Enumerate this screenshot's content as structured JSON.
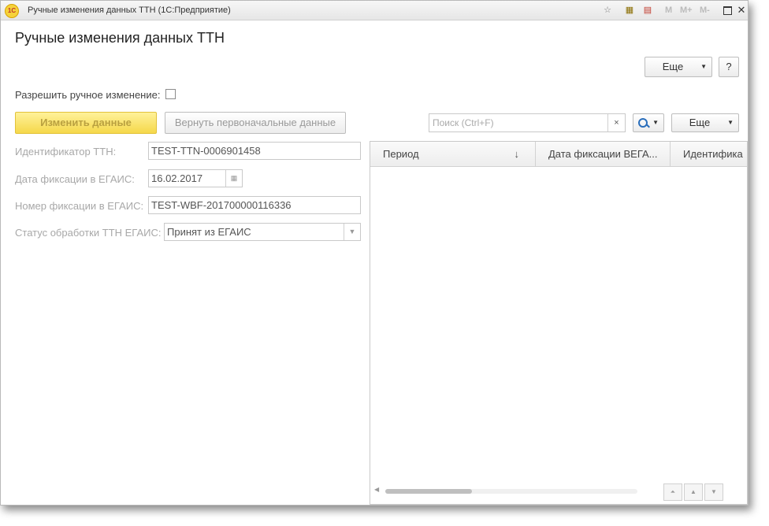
{
  "window": {
    "logo_text": "1C",
    "title": "Ручные изменения данных ТТН  (1С:Предприятие)",
    "toolbar_m": [
      "M",
      "M+",
      "M-"
    ]
  },
  "form": {
    "title": "Ручные изменения данных ТТН",
    "more_label": "Еще",
    "help_label": "?",
    "allow_manual_label": "Разрешить ручное изменение:",
    "change_button": "Изменить данные",
    "restore_button": "Вернуть первоначальные данные"
  },
  "fields": {
    "ttn_id_label": "Идентификатор ТТН:",
    "ttn_id_value": "TEST-TTN-0006901458",
    "fix_date_label": "Дата фиксации в ЕГАИС:",
    "fix_date_value": "16.02.2017",
    "fix_number_label": "Номер фиксации в ЕГАИС:",
    "fix_number_value": "TEST-WBF-201700000116336",
    "status_label": "Статус обработки ТТН ЕГАИС:",
    "status_value": "Принят из ЕГАИС"
  },
  "list": {
    "search_placeholder": "Поиск (Ctrl+F)",
    "clear_glyph": "×",
    "more_label": "Еще",
    "columns": [
      "Период",
      "Дата фиксации ВЕГА...",
      "Идентифика"
    ],
    "sort_glyph": "↓"
  }
}
